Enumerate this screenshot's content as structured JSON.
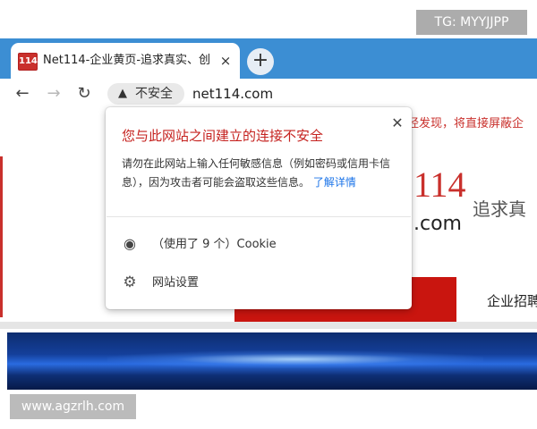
{
  "watermarks": {
    "top": "TG: MYYJJPP",
    "bottom": "www.agzrlh.com"
  },
  "browser": {
    "tab": {
      "favicon_text": "114",
      "title": "Net114-企业黄页-追求真实、创",
      "close_glyph": "×"
    },
    "new_tab_glyph": "+",
    "toolbar": {
      "back_glyph": "←",
      "forward_glyph": "→",
      "reload_glyph": "↻",
      "security_warning_glyph": "▲",
      "security_label": "不安全",
      "url": "net114.com"
    },
    "accent_color": "#3c8ed3"
  },
  "page": {
    "notice": "经发现，将直接屏蔽企",
    "logo_number": "114",
    "logo_domain": ".com",
    "slogan": "追求真",
    "nav_recruit": "企业招聘",
    "brand_red": "#c9150f"
  },
  "popup": {
    "title": "您与此网站之间建立的连接不安全",
    "body": "请勿在此网站上输入任何敏感信息（例如密码或信用卡信息），因为攻击者可能会盗取这些信息。",
    "learn_more": "了解详情",
    "close_glyph": "✕",
    "cookie_glyph": "◉",
    "cookie_text": "（使用了 9 个）Cookie",
    "settings_glyph": "⚙",
    "settings_text": "网站设置",
    "title_color": "#c5221f"
  }
}
